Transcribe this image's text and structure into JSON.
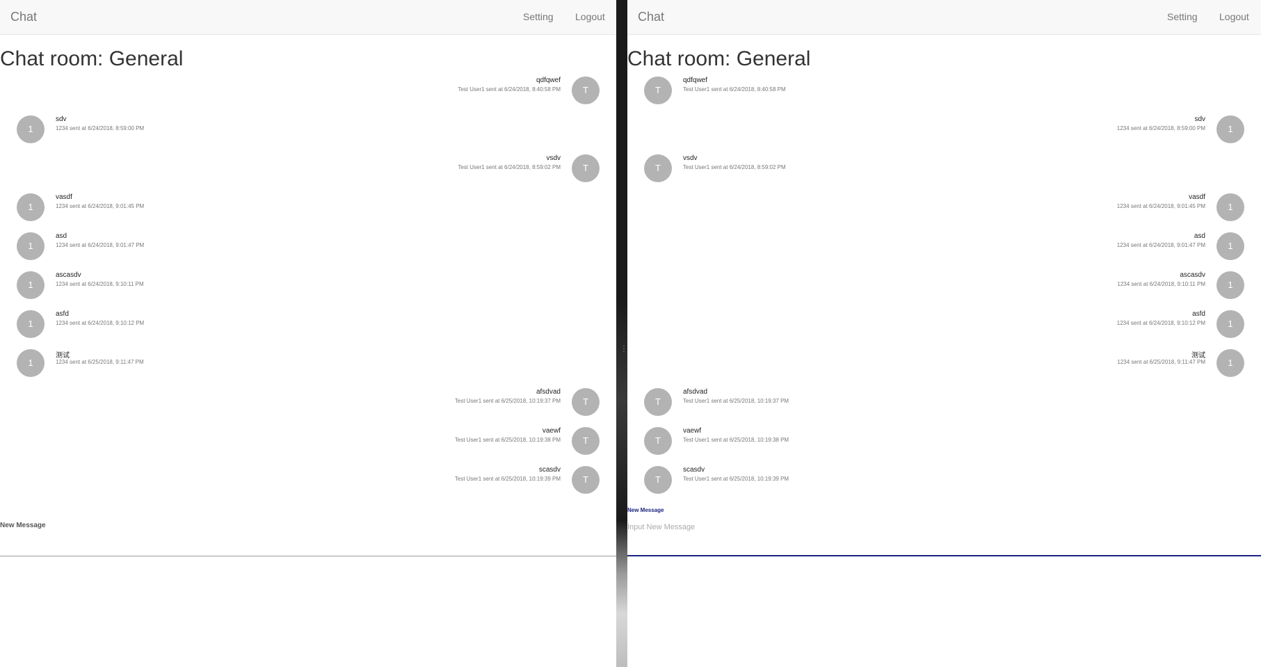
{
  "windows": [
    {
      "id": "left",
      "navbar": {
        "brand": "Chat",
        "setting": "Setting",
        "logout": "Logout"
      },
      "room_title": "Chat room: General",
      "messages": [
        {
          "text": "qdfqwef",
          "meta": "Test User1 sent at 6/24/2018, 8:40:58 PM",
          "avatar": "T",
          "side": "self"
        },
        {
          "text": "sdv",
          "meta": "1234 sent at 6/24/2018, 8:59:00 PM",
          "avatar": "1",
          "side": "other"
        },
        {
          "text": "vsdv",
          "meta": "Test User1 sent at 6/24/2018, 8:59:02 PM",
          "avatar": "T",
          "side": "self"
        },
        {
          "text": "vasdf",
          "meta": "1234 sent at 6/24/2018, 9:01:45 PM",
          "avatar": "1",
          "side": "other"
        },
        {
          "text": "asd",
          "meta": "1234 sent at 6/24/2018, 9:01:47 PM",
          "avatar": "1",
          "side": "other"
        },
        {
          "text": "ascasdv",
          "meta": "1234 sent at 6/24/2018, 9:10:11 PM",
          "avatar": "1",
          "side": "other"
        },
        {
          "text": "asfd",
          "meta": "1234 sent at 6/24/2018, 9:10:12 PM",
          "avatar": "1",
          "side": "other"
        },
        {
          "text": "测试",
          "meta": "1234 sent at 6/25/2018, 9:11:47 PM",
          "avatar": "1",
          "side": "other"
        },
        {
          "text": "afsdvad",
          "meta": "Test User1 sent at 6/25/2018, 10:19:37 PM",
          "avatar": "T",
          "side": "self"
        },
        {
          "text": "vaewf",
          "meta": "Test User1 sent at 6/25/2018, 10:19:38 PM",
          "avatar": "T",
          "side": "self"
        },
        {
          "text": "scasdv",
          "meta": "Test User1 sent at 6/25/2018, 10:19:39 PM",
          "avatar": "T",
          "side": "self"
        }
      ],
      "composer": {
        "label": "New Message",
        "placeholder": "",
        "value": "",
        "focused": false,
        "label_color": "#555555",
        "line_color": "#999999"
      }
    },
    {
      "id": "right",
      "navbar": {
        "brand": "Chat",
        "setting": "Setting",
        "logout": "Logout"
      },
      "room_title": "Chat room: General",
      "messages": [
        {
          "text": "qdfqwef",
          "meta": "Test User1 sent at 6/24/2018, 8:40:58 PM",
          "avatar": "T",
          "side": "other"
        },
        {
          "text": "sdv",
          "meta": "1234 sent at 6/24/2018, 8:59:00 PM",
          "avatar": "1",
          "side": "self"
        },
        {
          "text": "vsdv",
          "meta": "Test User1 sent at 6/24/2018, 8:59:02 PM",
          "avatar": "T",
          "side": "other"
        },
        {
          "text": "vasdf",
          "meta": "1234 sent at 6/24/2018, 9:01:45 PM",
          "avatar": "1",
          "side": "self"
        },
        {
          "text": "asd",
          "meta": "1234 sent at 6/24/2018, 9:01:47 PM",
          "avatar": "1",
          "side": "self"
        },
        {
          "text": "ascasdv",
          "meta": "1234 sent at 6/24/2018, 9:10:11 PM",
          "avatar": "1",
          "side": "self"
        },
        {
          "text": "asfd",
          "meta": "1234 sent at 6/24/2018, 9:10:12 PM",
          "avatar": "1",
          "side": "self"
        },
        {
          "text": "测试",
          "meta": "1234 sent at 6/25/2018, 9:11:47 PM",
          "avatar": "1",
          "side": "self"
        },
        {
          "text": "afsdvad",
          "meta": "Test User1 sent at 6/25/2018, 10:19:37 PM",
          "avatar": "T",
          "side": "other"
        },
        {
          "text": "vaewf",
          "meta": "Test User1 sent at 6/25/2018, 10:19:38 PM",
          "avatar": "T",
          "side": "other"
        },
        {
          "text": "scasdv",
          "meta": "Test User1 sent at 6/25/2018, 10:19:39 PM",
          "avatar": "T",
          "side": "other"
        }
      ],
      "composer": {
        "label": "New Message",
        "placeholder": "Input New Message",
        "value": "",
        "focused": true,
        "label_color": "#1a237e",
        "line_color": "#1a237e"
      }
    }
  ]
}
